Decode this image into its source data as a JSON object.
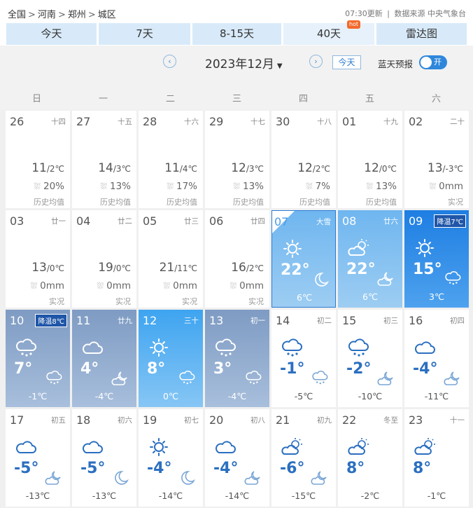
{
  "breadcrumb": {
    "items": [
      "全国",
      "河南",
      "郑州",
      "城区"
    ],
    "sep": ">"
  },
  "meta": {
    "updated": "07:30更新",
    "divider": "|",
    "source": "数据来源 中央气象台"
  },
  "tabs": [
    {
      "label": "今天"
    },
    {
      "label": "7天"
    },
    {
      "label": "8-15天"
    },
    {
      "label": "40天",
      "badge": "hot"
    },
    {
      "label": "雷达图"
    }
  ],
  "toolbar": {
    "prev": "‹",
    "next": "›",
    "month": "2023年12月",
    "today": "今天",
    "sunny_label": "蓝天预报",
    "toggle": "开"
  },
  "weekdays": [
    "日",
    "一",
    "二",
    "三",
    "四",
    "五",
    "六"
  ],
  "history": [
    {
      "day": "26",
      "lunar": "十四",
      "hi": "11",
      "lo": "/2℃",
      "rain": "20%",
      "note": "历史均值"
    },
    {
      "day": "27",
      "lunar": "十五",
      "hi": "14",
      "lo": "/3℃",
      "rain": "13%",
      "note": "历史均值"
    },
    {
      "day": "28",
      "lunar": "十六",
      "hi": "11",
      "lo": "/4℃",
      "rain": "17%",
      "note": "历史均值"
    },
    {
      "day": "29",
      "lunar": "十七",
      "hi": "12",
      "lo": "/3℃",
      "rain": "13%",
      "note": "历史均值"
    },
    {
      "day": "30",
      "lunar": "十八",
      "hi": "12",
      "lo": "/2℃",
      "rain": "7%",
      "note": "历史均值"
    },
    {
      "day": "01",
      "lunar": "十九",
      "hi": "12",
      "lo": "/0℃",
      "rain": "13%",
      "note": "历史均值"
    },
    {
      "day": "02",
      "lunar": "二十",
      "hi": "13",
      "lo": "/-3℃",
      "rain": "0mm",
      "note": "实况"
    },
    {
      "day": "03",
      "lunar": "廿一",
      "hi": "13",
      "lo": "/0℃",
      "rain": "0mm",
      "note": "实况"
    },
    {
      "day": "04",
      "lunar": "廿二",
      "hi": "19",
      "lo": "/0℃",
      "rain": "0mm",
      "note": "实况"
    },
    {
      "day": "05",
      "lunar": "廿三",
      "hi": "21",
      "lo": "/11℃",
      "rain": "0mm",
      "note": "实况"
    },
    {
      "day": "06",
      "lunar": "廿四",
      "hi": "16",
      "lo": "/2℃",
      "rain": "0mm",
      "note": "实况"
    }
  ],
  "forecast": [
    {
      "day": "07",
      "lunar": "大雪",
      "hi": "22°",
      "lo": "6℃",
      "icon1": "sun",
      "icon2": "moon",
      "style": "lightblue",
      "selected": true
    },
    {
      "day": "08",
      "lunar": "廿六",
      "hi": "22°",
      "lo": "6℃",
      "icon1": "partly-cloudy",
      "icon2": "night-cloudy",
      "style": "lightblue"
    },
    {
      "day": "09",
      "lunar": "",
      "warn": "降温7℃",
      "hi": "15°",
      "lo": "3℃",
      "icon1": "sun",
      "icon2": "rain-cloud",
      "style": "blue"
    },
    {
      "day": "10",
      "lunar": "",
      "warn": "降温8℃",
      "hi": "7°",
      "lo": "-1℃",
      "icon1": "rain-cloud",
      "icon2": "rain-cloud",
      "style": "grayblue"
    },
    {
      "day": "11",
      "lunar": "廿九",
      "hi": "4°",
      "lo": "-4℃",
      "icon1": "cloud",
      "icon2": "night-cloudy",
      "style": "grayblue"
    },
    {
      "day": "12",
      "lunar": "三十",
      "hi": "8°",
      "lo": "0℃",
      "icon1": "sun",
      "icon2": "rain-cloud",
      "style": "brightblue"
    },
    {
      "day": "13",
      "lunar": "初一",
      "hi": "3°",
      "lo": "-4℃",
      "icon1": "rain-cloud",
      "icon2": "rain-cloud",
      "style": "grayblue"
    },
    {
      "day": "14",
      "lunar": "初二",
      "hi": "-1°",
      "lo": "-5℃",
      "icon1": "rain-cloud",
      "icon2": "rain-cloud",
      "style": "light"
    },
    {
      "day": "15",
      "lunar": "初三",
      "hi": "-2°",
      "lo": "-10℃",
      "icon1": "rain-cloud",
      "icon2": "night-cloudy",
      "style": "light"
    },
    {
      "day": "16",
      "lunar": "初四",
      "hi": "-4°",
      "lo": "-11℃",
      "icon1": "cloud",
      "icon2": "night-cloudy",
      "style": "light"
    },
    {
      "day": "17",
      "lunar": "初五",
      "hi": "-5°",
      "lo": "-13℃",
      "icon1": "cloud",
      "icon2": "night-cloudy",
      "style": "light"
    },
    {
      "day": "18",
      "lunar": "初六",
      "hi": "-5°",
      "lo": "-13℃",
      "icon1": "cloud",
      "icon2": "moon",
      "style": "light"
    },
    {
      "day": "19",
      "lunar": "初七",
      "hi": "-4°",
      "lo": "-14℃",
      "icon1": "sun",
      "icon2": "moon",
      "style": "light"
    },
    {
      "day": "20",
      "lunar": "初八",
      "hi": "-4°",
      "lo": "-14℃",
      "icon1": "cloud",
      "icon2": "night-cloudy",
      "style": "light"
    },
    {
      "day": "21",
      "lunar": "初九",
      "hi": "-6°",
      "lo": "-15℃",
      "icon1": "partly-cloudy",
      "icon2": "night-cloudy",
      "style": "light"
    },
    {
      "day": "22",
      "lunar": "冬至",
      "hi": "8°",
      "lo": "-2℃",
      "icon1": "partly-cloudy",
      "icon2": "",
      "style": "light"
    },
    {
      "day": "23",
      "lunar": "十一",
      "hi": "8°",
      "lo": "-1℃",
      "icon1": "partly-cloudy",
      "icon2": "",
      "style": "light"
    }
  ],
  "colors": {
    "accent": "#2b7ad1",
    "tab_bg": "#d8eaf9",
    "hot": "#f26a2b"
  }
}
